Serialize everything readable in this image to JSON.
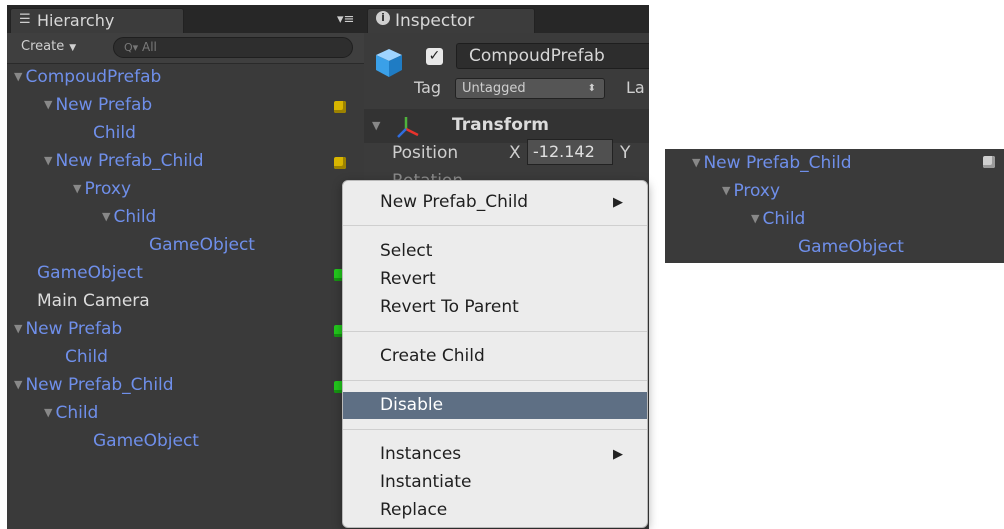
{
  "hierarchy": {
    "tab_label": "Hierarchy",
    "tab_icon": "list-icon",
    "menu_icon": "▾≡",
    "create_label": "Create",
    "search_placeholder": "All",
    "items": [
      {
        "label": "CompoudPrefab",
        "arrow": true
      },
      {
        "label": "New Prefab",
        "arrow": true
      },
      {
        "label": "Child",
        "arrow": false
      },
      {
        "label": "New Prefab_Child",
        "arrow": true
      },
      {
        "label": "Proxy",
        "arrow": true
      },
      {
        "label": "Child",
        "arrow": true
      },
      {
        "label": "GameObject",
        "arrow": false
      },
      {
        "label": "GameObject",
        "arrow": false
      },
      {
        "label": "Main Camera",
        "arrow": false
      },
      {
        "label": "New Prefab",
        "arrow": true
      },
      {
        "label": "Child",
        "arrow": false
      },
      {
        "label": "New Prefab_Child",
        "arrow": true
      },
      {
        "label": "Child",
        "arrow": true
      },
      {
        "label": "GameObject",
        "arrow": false
      }
    ]
  },
  "inspector": {
    "tab_label": "Inspector",
    "tab_icon": "info-icon",
    "object_name": "CompoudPrefab",
    "active_checked": true,
    "tag_label": "Tag",
    "tag_value": "Untagged",
    "layer_label": "La",
    "transform_label": "Transform",
    "position_label": "Position",
    "x_label": "X",
    "x_value": "-12.142",
    "y_label": "Y",
    "rotation_label": "Rotation"
  },
  "context_menu": {
    "items": [
      {
        "label": "New Prefab_Child",
        "submenu": true
      },
      {
        "label": "Select"
      },
      {
        "label": "Revert"
      },
      {
        "label": "Revert To Parent"
      },
      {
        "label": "Create Child"
      },
      {
        "label": "Disable",
        "highlighted": true
      },
      {
        "label": "Instances",
        "submenu": true
      },
      {
        "label": "Instantiate"
      },
      {
        "label": "Replace"
      }
    ]
  },
  "detail_panel": {
    "items": [
      {
        "label": "New Prefab_Child"
      },
      {
        "label": "Proxy"
      },
      {
        "label": "Child"
      },
      {
        "label": "GameObject"
      }
    ]
  },
  "colors": {
    "panel_bg": "#3a3a3a",
    "prefab_blue": "#6f8fea",
    "menu_highlight": "#5e6f84",
    "prefab_icon_yellow": "#d8b500",
    "prefab_icon_green": "#22c81c"
  }
}
